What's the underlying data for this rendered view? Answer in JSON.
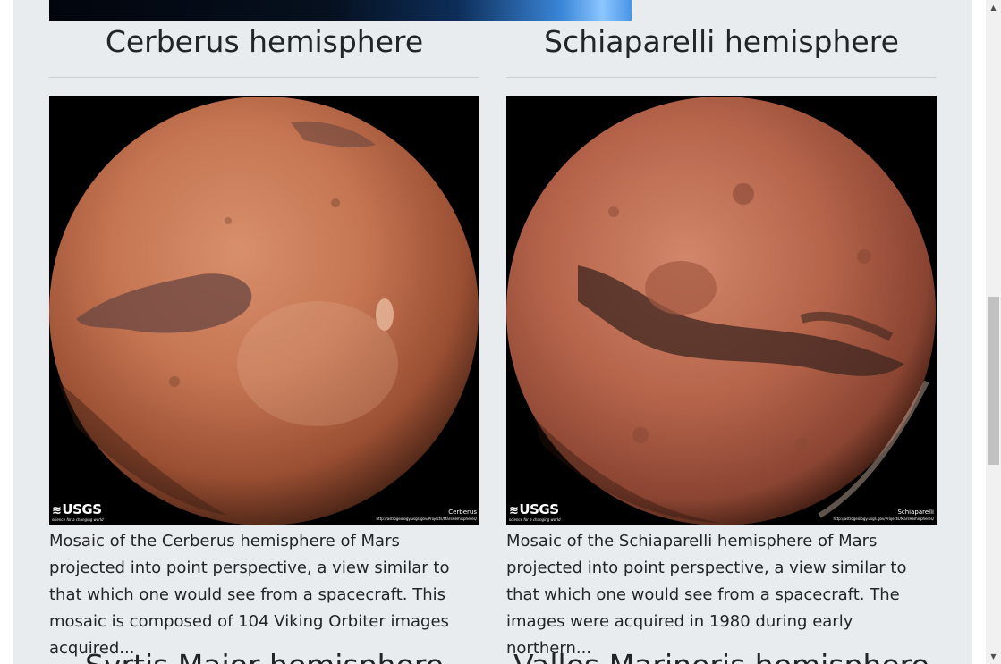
{
  "hemispheres": [
    {
      "title": "Cerberus hemisphere",
      "image_label": "Cerberus",
      "image_url_text": "http://astrogeology.usgs.gov/Projects/MarsHemispheres/",
      "description": "Mosaic of the Cerberus hemisphere of Mars projected into point perspective, a view similar to that which one would see from a spacecraft. This mosaic is composed of 104 Viking Orbiter images acquired..."
    },
    {
      "title": "Schiaparelli hemisphere",
      "image_label": "Schiaparelli",
      "image_url_text": "http://astrogeology.usgs.gov/Projects/MarsHemispheres/",
      "description": "Mosaic of the Schiaparelli hemisphere of Mars projected into point perspective, a view similar to that which one would see from a spacecraft. The images were acquired in 1980 during early northern..."
    }
  ],
  "next_titles": [
    "Syrtis Major hemisphere",
    "Valles Marineris hemisphere"
  ],
  "logo": {
    "name": "USGS",
    "tagline": "science for a changing world"
  },
  "colors": {
    "panel_bg": "#e9ecef",
    "text": "#212529",
    "mars_surface": "#c0684a"
  },
  "icons": {
    "scroll_up": "▲",
    "scroll_down": "▼"
  }
}
